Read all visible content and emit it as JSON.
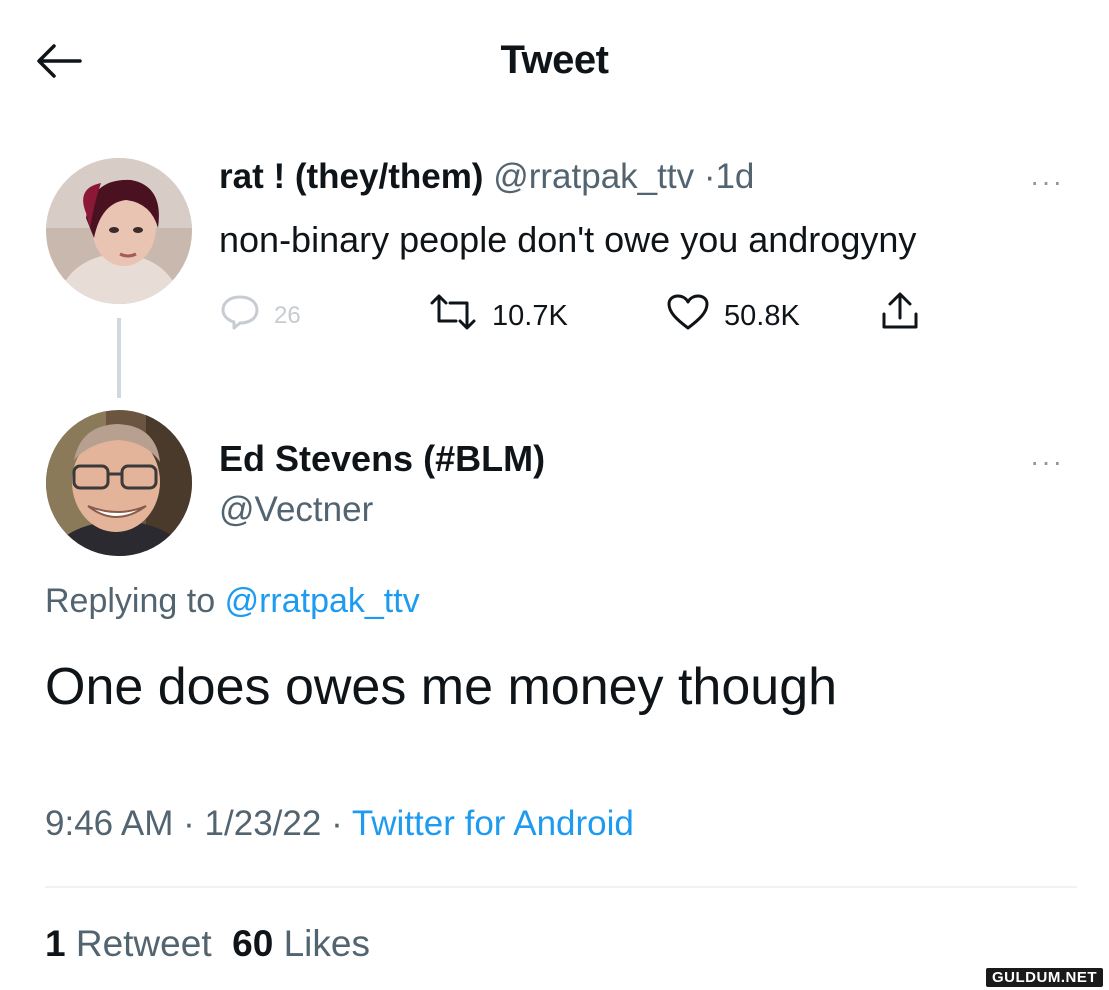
{
  "header": {
    "back_icon": "arrow-left-icon",
    "title": "Tweet"
  },
  "parent_tweet": {
    "name": "rat ! (they/them)",
    "handle": "@rratpak_ttv",
    "separator": "·",
    "age": "1d",
    "text": "non-binary people don't owe you androgyny",
    "more_label": "···",
    "actions": {
      "reply_icon": "reply-bubble-icon",
      "reply_count": "26",
      "retweet_icon": "retweet-icon",
      "retweet_count": "10.7K",
      "like_icon": "heart-icon",
      "like_count": "50.8K",
      "share_icon": "share-icon"
    }
  },
  "reply_tweet": {
    "name": "Ed Stevens (#BLM)",
    "handle": "@Vectner",
    "more_label": "···",
    "replying_prefix": "Replying to",
    "replying_to": "@rratpak_ttv",
    "text": "One does owes me money though",
    "time": "9:46 AM",
    "dot1": "·",
    "date": "1/23/22",
    "dot2": "·",
    "source": "Twitter for Android",
    "stats": {
      "retweets_count": "1",
      "retweets_label": "Retweet",
      "likes_count": "60",
      "likes_label": "Likes"
    }
  },
  "watermark": "GULDUM.NET",
  "colors": {
    "text": "#0f1419",
    "secondary": "#536471",
    "accent": "#1d9bf0",
    "divider": "#eff3f4"
  }
}
